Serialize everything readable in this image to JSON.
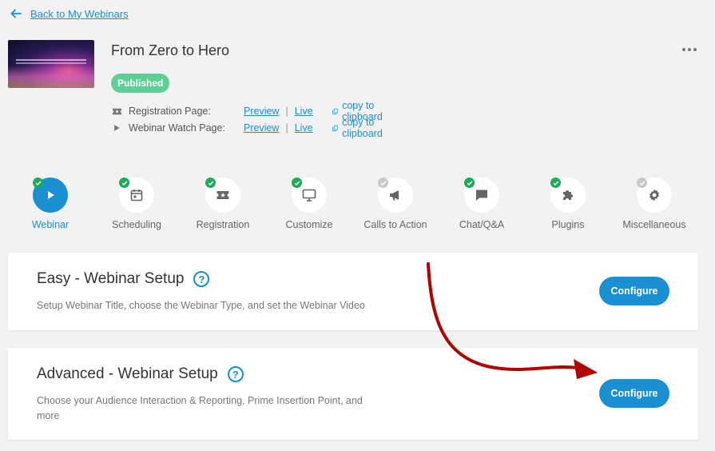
{
  "nav": {
    "back_label": "Back to My Webinars"
  },
  "webinar": {
    "title": "From Zero to Hero",
    "status": "Published",
    "status_color": "#5ccf94"
  },
  "links": [
    {
      "label": "Registration Page:",
      "preview": "Preview",
      "separator": "|",
      "live": "Live",
      "copy": "copy to clipboard",
      "icon": "ticket-icon"
    },
    {
      "label": "Webinar Watch Page:",
      "preview": "Preview",
      "separator": "|",
      "live": "Live",
      "copy": "copy to clipboard",
      "icon": "play-small-icon"
    }
  ],
  "steps": [
    {
      "label": "Webinar",
      "icon": "play-icon",
      "done": true,
      "active": true
    },
    {
      "label": "Scheduling",
      "icon": "calendar-icon",
      "done": true,
      "active": false
    },
    {
      "label": "Registration",
      "icon": "ticket-icon",
      "done": true,
      "active": false
    },
    {
      "label": "Customize",
      "icon": "monitor-icon",
      "done": true,
      "active": false
    },
    {
      "label": "Calls to Action",
      "icon": "megaphone-icon",
      "done": false,
      "active": false
    },
    {
      "label": "Chat/Q&A",
      "icon": "chat-icon",
      "done": true,
      "active": false
    },
    {
      "label": "Plugins",
      "icon": "puzzle-icon",
      "done": true,
      "active": false
    },
    {
      "label": "Miscellaneous",
      "icon": "gear-icon",
      "done": false,
      "active": false
    }
  ],
  "cards": {
    "easy": {
      "title": "Easy - Webinar Setup",
      "description": "Setup Webinar Title, choose the Webinar Type, and set the Webinar Video",
      "button": "Configure",
      "help": "?"
    },
    "advanced": {
      "title": "Advanced - Webinar Setup",
      "description_line1": "Choose your Audience Interaction & Reporting, Prime Insertion Point, and",
      "description_line2": "more",
      "button": "Configure",
      "help": "?"
    }
  },
  "colors": {
    "accent": "#1a8fd1",
    "check": "#1faa5a",
    "arrow": "#b00000"
  }
}
